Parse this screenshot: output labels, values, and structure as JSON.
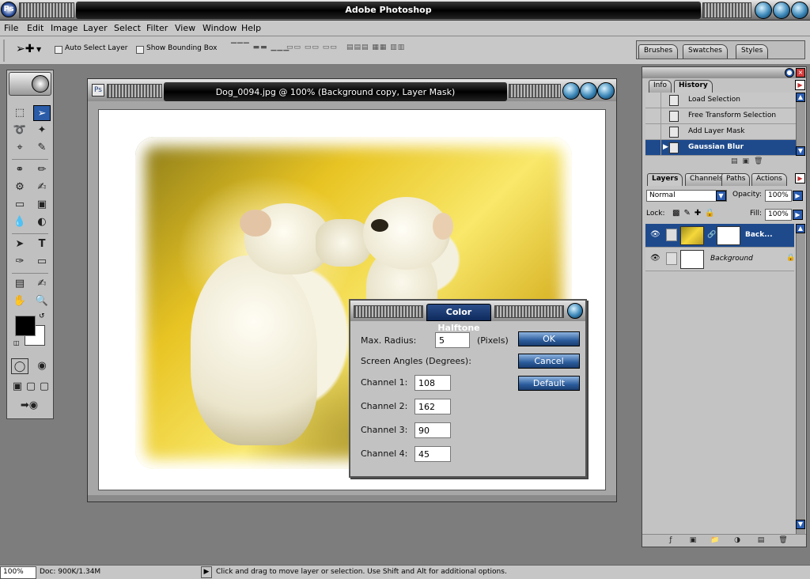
{
  "app": {
    "title": "Adobe Photoshop",
    "logo": "ps-logo-icon"
  },
  "menu": [
    "File",
    "Edit",
    "Image",
    "Layer",
    "Select",
    "Filter",
    "View",
    "Window",
    "Help"
  ],
  "options": {
    "auto_select_label": "Auto Select Layer",
    "bounding_box_label": "Show Bounding Box",
    "auto_select_checked": false,
    "bounding_box_checked": false
  },
  "palette_well_tabs": [
    "Brushes",
    "Swatches",
    "Styles"
  ],
  "document": {
    "title": "Dog_0094.jpg @ 100% (Background copy, Layer Mask)"
  },
  "dialog": {
    "title": "Color Halftone",
    "max_radius_label": "Max. Radius:",
    "max_radius_value": "5",
    "pixels_label": "(Pixels)",
    "screen_angles_label": "Screen Angles (Degrees):",
    "channels": [
      {
        "label": "Channel 1:",
        "value": "108"
      },
      {
        "label": "Channel 2:",
        "value": "162"
      },
      {
        "label": "Channel 3:",
        "value": "90"
      },
      {
        "label": "Channel 4:",
        "value": "45"
      }
    ],
    "ok_label": "OK",
    "cancel_label": "Cancel",
    "default_label": "Default"
  },
  "history_palette": {
    "tabs": [
      "Info",
      "History"
    ],
    "items": [
      "Load Selection",
      "Free Transform Selection",
      "Add Layer Mask",
      "Gaussian Blur"
    ],
    "selected_index": 3
  },
  "layers_palette": {
    "tabs": [
      "Layers",
      "Channels",
      "Paths",
      "Actions"
    ],
    "blend_mode": "Normal",
    "opacity_label": "Opacity:",
    "opacity_value": "100%",
    "lock_label": "Lock:",
    "fill_label": "Fill:",
    "fill_value": "100%",
    "layers": [
      {
        "name": "Back...",
        "selected": true
      },
      {
        "name": "Background",
        "selected": false
      }
    ]
  },
  "status": {
    "zoom": "100%",
    "doc": "Doc: 900K/1.34M",
    "message": "Click and drag to move layer or selection.  Use Shift and Alt for additional options."
  },
  "colors": {
    "accent": "#1e4a8c",
    "foreground": "#000000",
    "background": "#ffffff"
  }
}
